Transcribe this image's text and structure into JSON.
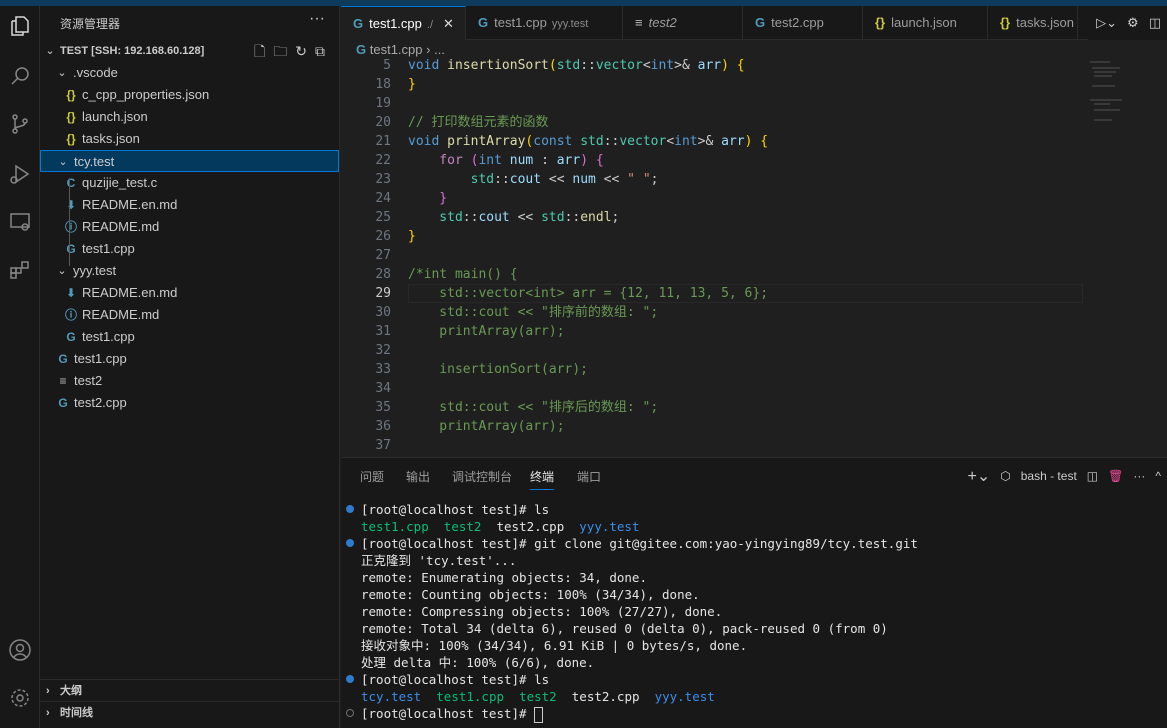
{
  "sidebar": {
    "title": "资源管理器",
    "more": "···",
    "workspace": "TEST [SSH: 192.168.60.128]",
    "tree": [
      {
        "label": ".vscode",
        "type": "folder",
        "depth": 1
      },
      {
        "label": "c_cpp_properties.json",
        "type": "json",
        "depth": 2
      },
      {
        "label": "launch.json",
        "type": "json",
        "depth": 2
      },
      {
        "label": "tasks.json",
        "type": "json",
        "depth": 2
      },
      {
        "label": "tcy.test",
        "type": "folder",
        "depth": 1,
        "selected": true
      },
      {
        "label": "quzijie_test.c",
        "type": "c",
        "depth": 2
      },
      {
        "label": "README.en.md",
        "type": "md-down",
        "depth": 2
      },
      {
        "label": "README.md",
        "type": "info",
        "depth": 2
      },
      {
        "label": "test1.cpp",
        "type": "cpp",
        "depth": 2
      },
      {
        "label": "yyy.test",
        "type": "folder",
        "depth": 1
      },
      {
        "label": "README.en.md",
        "type": "md-down",
        "depth": 2
      },
      {
        "label": "README.md",
        "type": "info",
        "depth": 2
      },
      {
        "label": "test1.cpp",
        "type": "cpp",
        "depth": 2
      },
      {
        "label": "test1.cpp",
        "type": "cpp",
        "depth": 1
      },
      {
        "label": "test2",
        "type": "text",
        "depth": 1
      },
      {
        "label": "test2.cpp",
        "type": "cpp",
        "depth": 1
      }
    ],
    "sections": [
      "大纲",
      "时间线"
    ]
  },
  "tabs": [
    {
      "label": "test1.cpp",
      "desc": "",
      "modified": "./",
      "active": true,
      "icon": "cpp"
    },
    {
      "label": "test1.cpp",
      "desc": "yyy.test",
      "icon": "cpp"
    },
    {
      "label": "test2",
      "desc": "",
      "icon": "text",
      "italic": true
    },
    {
      "label": "test2.cpp",
      "desc": "",
      "icon": "cpp"
    },
    {
      "label": "launch.json",
      "desc": "",
      "icon": "json"
    },
    {
      "label": "tasks.json",
      "desc": "",
      "icon": "json"
    }
  ],
  "breadcrumb": {
    "file": "test1.cpp",
    "rest": "..."
  },
  "editor": {
    "current_line": 29,
    "lines": [
      {
        "n": 5,
        "t": [
          [
            "void ",
            "kw"
          ],
          [
            "insertionSort",
            "fn"
          ],
          [
            "(",
            "pn"
          ],
          [
            "std",
            "ns"
          ],
          [
            "::",
            "c"
          ],
          [
            "vector",
            "ty"
          ],
          [
            "<",
            "c"
          ],
          [
            "int",
            "kw"
          ],
          [
            ">& ",
            "c"
          ],
          [
            "arr",
            "vr"
          ],
          [
            ") {",
            "pn"
          ]
        ]
      },
      {
        "n": 18,
        "t": [
          [
            "}",
            "pn"
          ]
        ]
      },
      {
        "n": 19,
        "t": []
      },
      {
        "n": 20,
        "t": [
          [
            "// 打印数组元素的函数",
            "cm"
          ]
        ]
      },
      {
        "n": 21,
        "t": [
          [
            "void ",
            "kw"
          ],
          [
            "printArray",
            "fn"
          ],
          [
            "(",
            "pn"
          ],
          [
            "const ",
            "kw"
          ],
          [
            "std",
            "ns"
          ],
          [
            "::",
            "c"
          ],
          [
            "vector",
            "ty"
          ],
          [
            "<",
            "c"
          ],
          [
            "int",
            "kw"
          ],
          [
            ">& ",
            "c"
          ],
          [
            "arr",
            "vr"
          ],
          [
            ") {",
            "pn"
          ]
        ]
      },
      {
        "n": 22,
        "t": [
          [
            "    for ",
            "ctl"
          ],
          [
            "(",
            "pp"
          ],
          [
            "int ",
            "kw"
          ],
          [
            "num",
            "vr"
          ],
          [
            " : ",
            "c"
          ],
          [
            "arr",
            "vr"
          ],
          [
            ") {",
            "pp"
          ]
        ]
      },
      {
        "n": 23,
        "t": [
          [
            "        std",
            "ns"
          ],
          [
            "::",
            "c"
          ],
          [
            "cout",
            "vr"
          ],
          [
            " << ",
            "c"
          ],
          [
            "num",
            "vr"
          ],
          [
            " << ",
            "c"
          ],
          [
            "\" \"",
            "st"
          ],
          [
            ";",
            "c"
          ]
        ]
      },
      {
        "n": 24,
        "t": [
          [
            "    }",
            "pp"
          ]
        ]
      },
      {
        "n": 25,
        "t": [
          [
            "    std",
            "ns"
          ],
          [
            "::",
            "c"
          ],
          [
            "cout",
            "vr"
          ],
          [
            " << ",
            "c"
          ],
          [
            "std",
            "ns"
          ],
          [
            "::",
            "c"
          ],
          [
            "endl",
            "fn"
          ],
          [
            ";",
            "c"
          ]
        ]
      },
      {
        "n": 26,
        "t": [
          [
            "}",
            "pn"
          ]
        ]
      },
      {
        "n": 27,
        "t": []
      },
      {
        "n": 28,
        "t": [
          [
            "/*int main() {",
            "cm"
          ]
        ]
      },
      {
        "n": 29,
        "t": [
          [
            "    std::vector<int> arr = {12, 11, 13, 5, 6};",
            "cm"
          ]
        ]
      },
      {
        "n": 30,
        "t": [
          [
            "    std::cout << \"排序前的数组: \";",
            "cm"
          ]
        ]
      },
      {
        "n": 31,
        "t": [
          [
            "    printArray(arr);",
            "cm"
          ]
        ]
      },
      {
        "n": 32,
        "t": []
      },
      {
        "n": 33,
        "t": [
          [
            "    insertionSort(arr);",
            "cm"
          ]
        ]
      },
      {
        "n": 34,
        "t": []
      },
      {
        "n": 35,
        "t": [
          [
            "    std::cout << \"排序后的数组: \";",
            "cm"
          ]
        ]
      },
      {
        "n": 36,
        "t": [
          [
            "    printArray(arr);",
            "cm"
          ]
        ]
      },
      {
        "n": 37,
        "t": []
      }
    ]
  },
  "panel": {
    "tabs": [
      "问题",
      "输出",
      "调试控制台",
      "终端",
      "端口"
    ],
    "active_tab": "终端",
    "terminal_name": "bash - test"
  },
  "terminal": [
    {
      "dot": "filled",
      "t": [
        [
          "[root@localhost test]# ls",
          "w"
        ]
      ]
    },
    {
      "t": [
        [
          "test1.cpp",
          "g2"
        ],
        [
          "  ",
          ""
        ],
        [
          "test2",
          "g2"
        ],
        [
          "  test2.cpp  ",
          "w"
        ],
        [
          "yyy.test",
          "b"
        ]
      ]
    },
    {
      "dot": "filled",
      "t": [
        [
          "[root@localhost test]# git clone git@gitee.com:yao-yingying89/tcy.test.git",
          "w"
        ]
      ]
    },
    {
      "t": [
        [
          "正克隆到 'tcy.test'...",
          "w"
        ]
      ]
    },
    {
      "t": [
        [
          "remote: Enumerating objects: 34, done.",
          "w"
        ]
      ]
    },
    {
      "t": [
        [
          "remote: Counting objects: 100% (34/34), done.",
          "w"
        ]
      ]
    },
    {
      "t": [
        [
          "remote: Compressing objects: 100% (27/27), done.",
          "w"
        ]
      ]
    },
    {
      "t": [
        [
          "remote: Total 34 (delta 6), reused 0 (delta 0), pack-reused 0 (from 0)",
          "w"
        ]
      ]
    },
    {
      "t": [
        [
          "接收对象中: 100% (34/34), 6.91 KiB | 0 bytes/s, done.",
          "w"
        ]
      ]
    },
    {
      "t": [
        [
          "处理 delta 中: 100% (6/6), done.",
          "w"
        ]
      ]
    },
    {
      "dot": "filled",
      "t": [
        [
          "[root@localhost test]# ls",
          "w"
        ]
      ]
    },
    {
      "t": [
        [
          "tcy.test",
          "b"
        ],
        [
          "  ",
          ""
        ],
        [
          "test1.cpp",
          "g2"
        ],
        [
          "  ",
          ""
        ],
        [
          "test2",
          "g2"
        ],
        [
          "  test2.cpp  ",
          "w"
        ],
        [
          "yyy.test",
          "b"
        ]
      ]
    },
    {
      "dot": "hollow",
      "cursor": true,
      "t": [
        [
          "[root@localhost test]# ",
          "w"
        ]
      ]
    }
  ]
}
